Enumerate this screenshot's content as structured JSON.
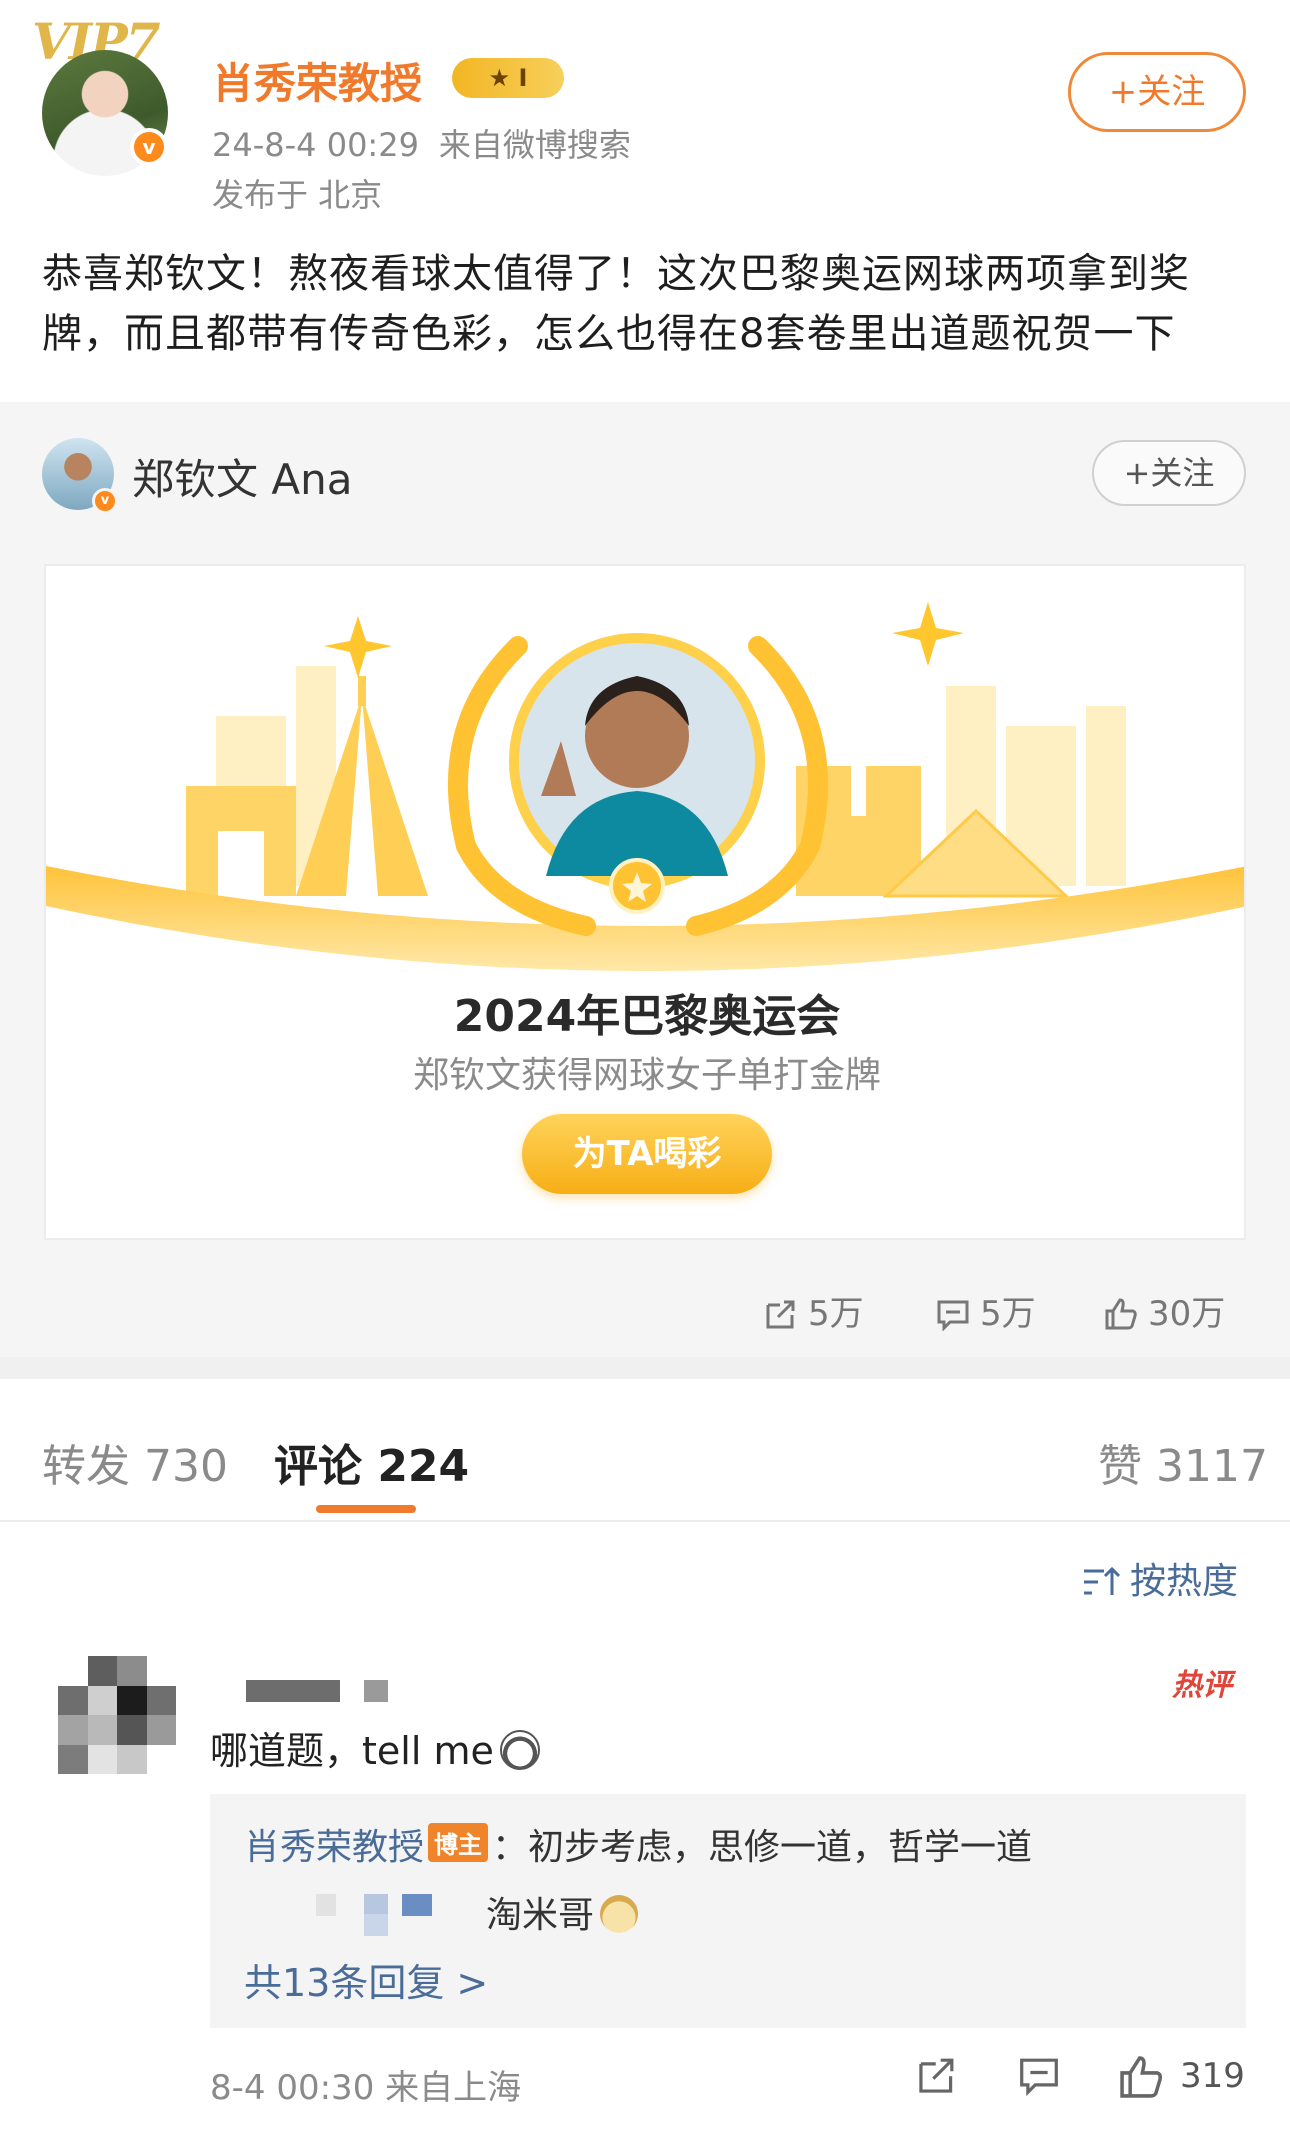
{
  "post": {
    "vip_label": "VIP7",
    "author": "肖秀荣教授",
    "badge_label": "I",
    "date": "24-8-4 00:29",
    "source": "来自微博搜索",
    "location": "发布于 北京",
    "follow_label": "+关注",
    "text": "恭喜郑钦文！熬夜看球太值得了！这次巴黎奥运网球两项拿到奖牌，而且都带有传奇色彩，怎么也得在8套卷里出道题祝贺一下"
  },
  "repost": {
    "author": "郑钦文 Ana",
    "follow_label": "+关注",
    "banner_title": "2024年巴黎奥运会",
    "banner_subtitle": "郑钦文获得网球女子单打金牌",
    "cheer_label": "为TA喝彩",
    "shares": "5万",
    "comments": "5万",
    "likes": "30万"
  },
  "tabs": {
    "repost_label": "转发 730",
    "comment_label": "评论 224",
    "like_label": "赞 3117",
    "sort_label": "按热度"
  },
  "comment": {
    "hot_tag": "热评",
    "text": "哪道题，tell me",
    "reply_author": "肖秀荣教授",
    "reply_badge": "博主",
    "reply_text": "：初步考虑，思修一道，哲学一道",
    "reply2_text": "淘米哥",
    "more_replies": "共13条回复 >",
    "time": "8-4 00:30",
    "location": "来自上海",
    "likes": "319"
  },
  "colors": {
    "accent": "#f07a2c",
    "link": "#4a6c98",
    "gold": "#f7ae16",
    "hot": "#e0453a"
  },
  "icons": {
    "share": "share-icon",
    "comment": "comment-icon",
    "like": "thumbs-up-icon",
    "sort": "sort-icon",
    "verified": "verified-icon"
  }
}
